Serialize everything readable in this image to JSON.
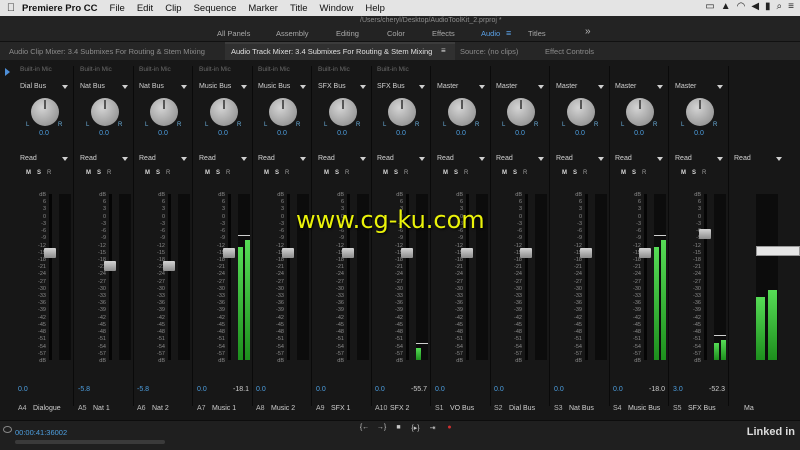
{
  "menubar": {
    "app_name": "Premiere Pro CC",
    "items": [
      "File",
      "Edit",
      "Clip",
      "Sequence",
      "Marker",
      "Title",
      "Window",
      "Help"
    ],
    "project_path": "/Users/cheryl/Desktop/AudioToolKit_2.prproj *"
  },
  "workspaces": {
    "items": [
      "All Panels",
      "Assembly",
      "Editing",
      "Color",
      "Effects",
      "Audio",
      "Titles"
    ],
    "active": "Audio",
    "more": "»"
  },
  "tabs": {
    "clip_mixer": "Audio Clip Mixer: 3.4 Submixes For Routing & Stem Mixing",
    "track_mixer": "Audio Track Mixer: 3.4 Submixes For Routing & Stem Mixing",
    "track_mixer_menu": "≡",
    "source": "Source: (no clips)",
    "effect_controls": "Effect Controls"
  },
  "meter_scale": [
    "dB",
    "6",
    "3",
    "0",
    "-3",
    "-6",
    "-9",
    "-12",
    "-15",
    "-18",
    "-21",
    "-24",
    "-27",
    "-30",
    "-33",
    "-36",
    "-39",
    "-42",
    "-45",
    "-48",
    "-51",
    "-54",
    "-57",
    "dB"
  ],
  "channels": [
    {
      "id": "A4",
      "name": "Dialogue",
      "input": "Built-in Mic",
      "route": "Dial Bus",
      "pan": "0.0",
      "automation": "Read",
      "volume": "0.0",
      "peak": "",
      "fader": 0.66,
      "meter_l": 0,
      "meter_r": 0
    },
    {
      "id": "A5",
      "name": "Nat 1",
      "input": "Built-in Mic",
      "route": "Nat Bus",
      "pan": "0.0",
      "automation": "Read",
      "volume": "-5.8",
      "peak": "",
      "fader": 0.58,
      "meter_l": 0,
      "meter_r": 0
    },
    {
      "id": "A6",
      "name": "Nat 2",
      "input": "Built-in Mic",
      "route": "Nat Bus",
      "pan": "0.0",
      "automation": "Read",
      "volume": "-5.8",
      "peak": "",
      "fader": 0.58,
      "meter_l": 0,
      "meter_r": 0
    },
    {
      "id": "A7",
      "name": "Music 1",
      "input": "Built-in Mic",
      "route": "Music Bus",
      "pan": "0.0",
      "automation": "Read",
      "volume": "0.0",
      "peak": "-18.1",
      "fader": 0.66,
      "meter_l": 0.68,
      "meter_r": 0.72
    },
    {
      "id": "A8",
      "name": "Music 2",
      "input": "Built-in Mic",
      "route": "Music Bus",
      "pan": "0.0",
      "automation": "Read",
      "volume": "0.0",
      "peak": "",
      "fader": 0.66,
      "meter_l": 0,
      "meter_r": 0
    },
    {
      "id": "A9",
      "name": "SFX 1",
      "input": "Built-in Mic",
      "route": "SFX Bus",
      "pan": "0.0",
      "automation": "Read",
      "volume": "0.0",
      "peak": "",
      "fader": 0.66,
      "meter_l": 0,
      "meter_r": 0
    },
    {
      "id": "A10",
      "name": "SFX 2",
      "input": "Built-in Mic",
      "route": "SFX Bus",
      "pan": "0.0",
      "automation": "Read",
      "volume": "0.0",
      "peak": "-55.7",
      "fader": 0.66,
      "meter_l": 0.07,
      "meter_r": 0
    },
    {
      "id": "S1",
      "name": "VO Bus",
      "input": "",
      "route": "Master",
      "pan": "0.0",
      "automation": "Read",
      "volume": "0.0",
      "peak": "",
      "fader": 0.66,
      "meter_l": 0,
      "meter_r": 0
    },
    {
      "id": "S2",
      "name": "Dial Bus",
      "input": "",
      "route": "Master",
      "pan": "0.0",
      "automation": "Read",
      "volume": "0.0",
      "peak": "",
      "fader": 0.66,
      "meter_l": 0,
      "meter_r": 0
    },
    {
      "id": "S3",
      "name": "Nat Bus",
      "input": "",
      "route": "Master",
      "pan": "0.0",
      "automation": "Read",
      "volume": "0.0",
      "peak": "",
      "fader": 0.66,
      "meter_l": 0,
      "meter_r": 0
    },
    {
      "id": "S4",
      "name": "Music Bus",
      "input": "",
      "route": "Master",
      "pan": "0.0",
      "automation": "Read",
      "volume": "0.0",
      "peak": "-18.0",
      "fader": 0.66,
      "meter_l": 0.68,
      "meter_r": 0.72
    },
    {
      "id": "S5",
      "name": "SFX Bus",
      "input": "",
      "route": "Master",
      "pan": "0.0",
      "automation": "Read",
      "volume": "3.0",
      "peak": "-52.3",
      "fader": 0.78,
      "meter_l": 0.1,
      "meter_r": 0.12
    }
  ],
  "master": {
    "name": "Ma",
    "automation": "Read",
    "meter_l": 0.38,
    "meter_r": 0.42
  },
  "bottom": {
    "timecode": "00:00:41:36002",
    "transport": [
      "{←",
      "→}",
      "■",
      "{▸}",
      "⇥",
      "●"
    ],
    "brand": "Linked in"
  },
  "overlay": "www.cg-ku.com",
  "colors": {
    "accent": "#4d9fe0",
    "meter_green": "#3fbf3f",
    "background": "#171717"
  }
}
